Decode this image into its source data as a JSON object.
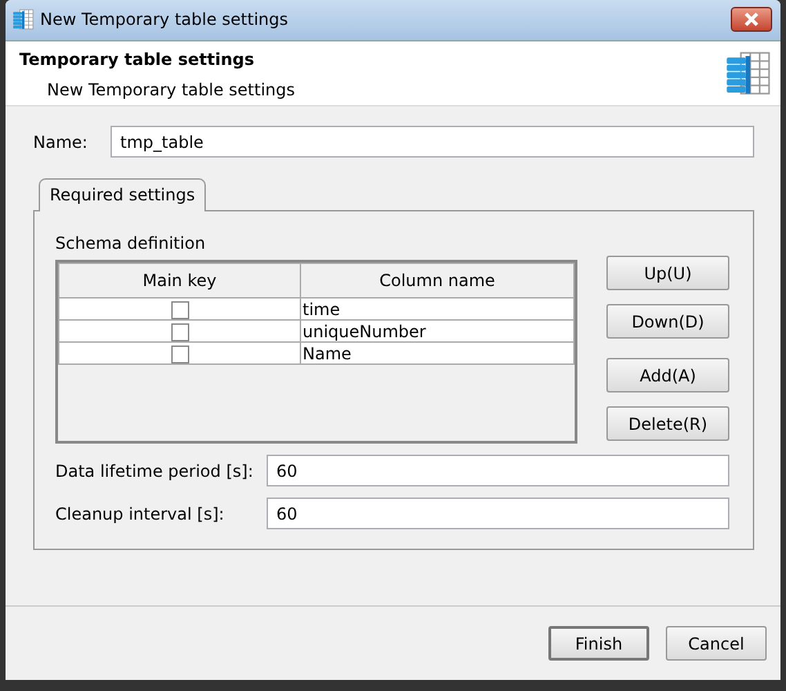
{
  "window": {
    "title": "New Temporary table settings"
  },
  "header": {
    "title": "Temporary table settings",
    "subtitle": "New Temporary table settings"
  },
  "name_field": {
    "label": "Name:",
    "value": "tmp_table"
  },
  "tabs": [
    {
      "label": "Required settings",
      "selected": true
    }
  ],
  "schema": {
    "label": "Schema definition",
    "columns": [
      "Main key",
      "Column name"
    ],
    "rows": [
      {
        "main_key": false,
        "column_name": "time"
      },
      {
        "main_key": false,
        "column_name": "uniqueNumber"
      },
      {
        "main_key": false,
        "column_name": "Name"
      }
    ],
    "buttons": [
      "Up(U)",
      "Down(D)",
      "Add(A)",
      "Delete(R)"
    ]
  },
  "fields": [
    {
      "label": "Data lifetime period [s]:",
      "value": "60"
    },
    {
      "label": "Cleanup interval [s]:",
      "value": "60"
    }
  ],
  "buttons": [
    {
      "label": "Finish",
      "default": true
    },
    {
      "label": "Cancel",
      "default": false
    }
  ]
}
